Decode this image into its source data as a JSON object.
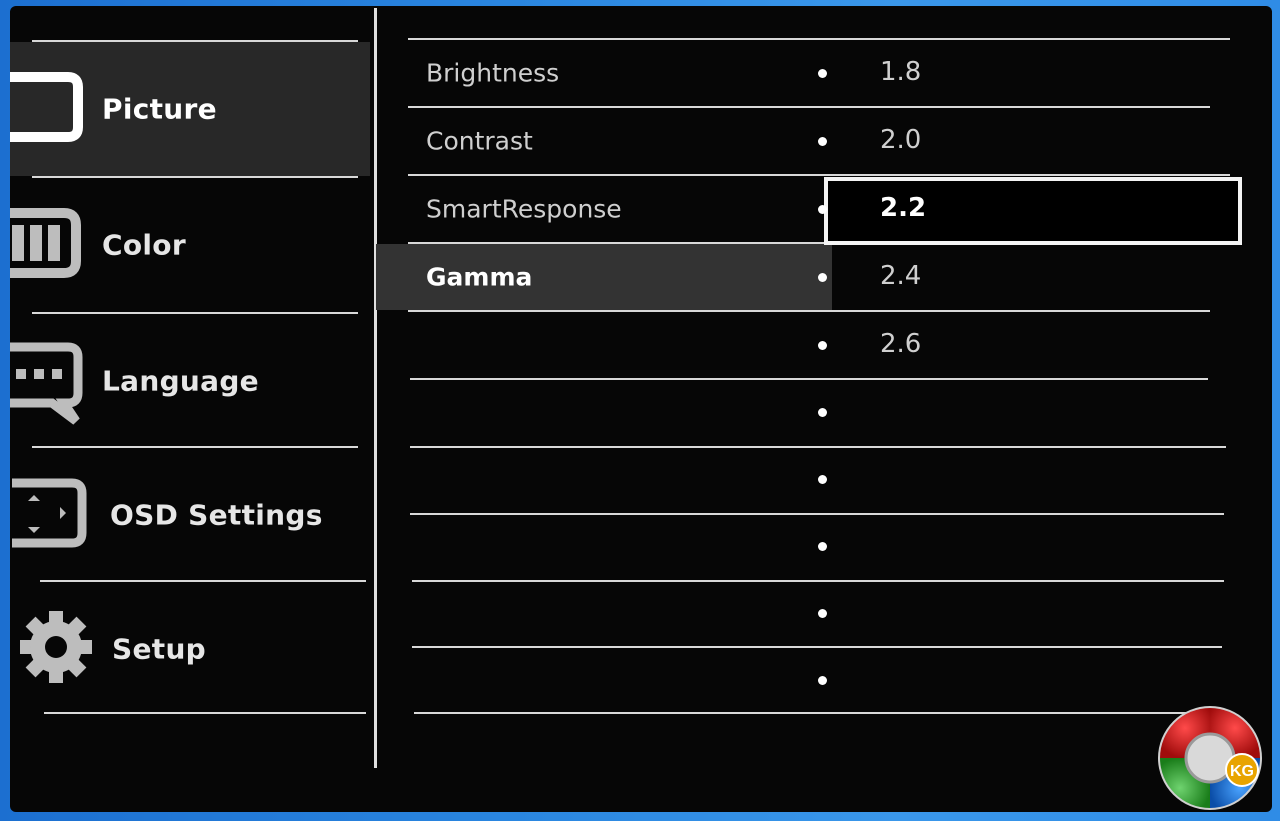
{
  "menu": {
    "items": [
      {
        "label": "Picture",
        "icon": "picture-icon",
        "active": true
      },
      {
        "label": "Color",
        "icon": "color-icon",
        "active": false
      },
      {
        "label": "Language",
        "icon": "language-icon",
        "active": false
      },
      {
        "label": "OSD Settings",
        "icon": "osd-settings-icon",
        "active": false
      },
      {
        "label": "Setup",
        "icon": "gear-icon",
        "active": false
      }
    ]
  },
  "submenu": {
    "items": [
      {
        "label": "Brightness"
      },
      {
        "label": "Contrast"
      },
      {
        "label": "SmartResponse"
      },
      {
        "label": "Gamma",
        "active": true
      }
    ]
  },
  "options": {
    "values": [
      "1.8",
      "2.0",
      "2.2",
      "2.4",
      "2.6",
      "",
      "",
      "",
      "",
      ""
    ],
    "selected": "2.2"
  },
  "logo": {
    "text": "KG"
  },
  "colors": {
    "osd_bg": "#060606",
    "highlight": "#333333",
    "desktop": "#2a86e0"
  }
}
